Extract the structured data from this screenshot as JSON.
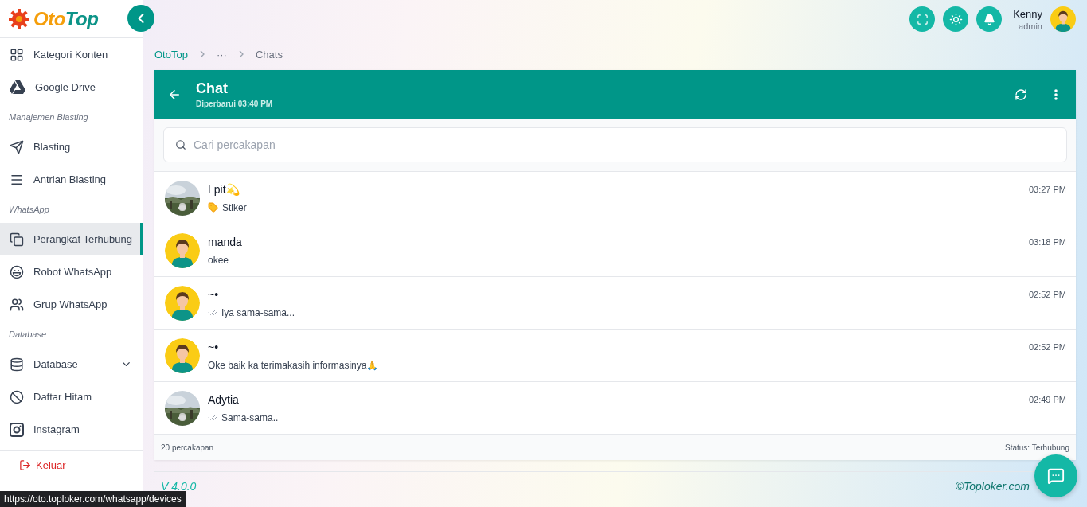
{
  "sidebar": {
    "logo": [
      "Oto",
      "Top"
    ],
    "items": [
      {
        "kind": "item",
        "label": "Kategori Konten",
        "selected": false
      },
      {
        "kind": "item",
        "label": "Google Drive",
        "selected": false
      },
      {
        "kind": "section",
        "label": "Manajemen Blasting"
      },
      {
        "kind": "item",
        "label": "Blasting",
        "selected": false
      },
      {
        "kind": "item",
        "label": "Antrian Blasting",
        "selected": false
      },
      {
        "kind": "section",
        "label": "WhatsApp"
      },
      {
        "kind": "item",
        "label": "Perangkat Terhubung",
        "selected": true
      },
      {
        "kind": "item",
        "label": "Robot WhatsApp",
        "selected": false
      },
      {
        "kind": "item",
        "label": "Grup WhatsApp",
        "selected": false
      },
      {
        "kind": "section",
        "label": "Database"
      },
      {
        "kind": "group",
        "label": "Database",
        "selected": false,
        "expanded": false
      },
      {
        "kind": "item",
        "label": "Daftar Hitam",
        "selected": false
      },
      {
        "kind": "item",
        "label": "Instagram",
        "selected": false
      }
    ],
    "logout": "Keluar"
  },
  "user": {
    "name": "Kenny",
    "role": "admin"
  },
  "breadcrumb": [
    "OtoTop",
    "···",
    "Chats"
  ],
  "chat": {
    "title": "Chat",
    "subtitle": "Diperbarui 03:40 PM",
    "search": {
      "placeholder": "Cari percakapan"
    },
    "conversations": [
      {
        "name": "Lpit💫",
        "preview": {
          "kind": "sticker",
          "text": "Stiker"
        },
        "time": "03:27 PM"
      },
      {
        "name": "manda",
        "preview": {
          "kind": "text",
          "text": "okee"
        },
        "time": "03:18 PM",
        "avatar": {
          "kind": "default"
        }
      },
      {
        "name": "~•",
        "preview": {
          "kind": "read",
          "text": "Iya sama-sama..."
        },
        "time": "02:52 PM",
        "avatar": {
          "kind": "default"
        }
      },
      {
        "name": "~•",
        "preview": {
          "kind": "text",
          "text": "Oke baik ka terimakasih informasinya🙏"
        },
        "time": "02:52 PM",
        "avatar": {
          "kind": "default"
        }
      },
      {
        "name": "Adytia",
        "preview": {
          "kind": "read",
          "text": "Sama-sama.."
        },
        "time": "02:49 PM"
      }
    ],
    "count": "20 percakapan",
    "status": "Status: Terhubung"
  },
  "footer": {
    "version": "V 4.0.0",
    "copyright": "©Toploker.com"
  },
  "status_url": "https://oto.toploker.com/whatsapp/devices"
}
